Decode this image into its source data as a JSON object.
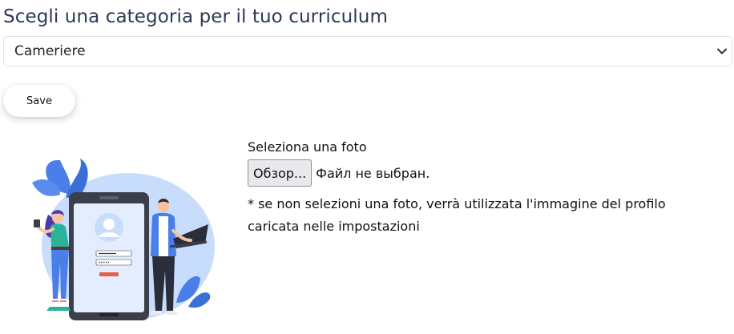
{
  "page": {
    "title": "Scegli una categoria per il tuo curriculum"
  },
  "category_select": {
    "selected": "Cameriere",
    "icon": "chevron-down-icon"
  },
  "save_button": {
    "label": "Save"
  },
  "photo_upload": {
    "label": "Seleziona una foto",
    "browse_label": "Обзор...",
    "file_status": "Файл не выбран.",
    "note": "* se non selezioni una foto, verrà utilizzata l'immagine del profilo caricata nelle impostazioni"
  },
  "colors": {
    "title": "#2b3a55",
    "illustration_blue": "#4a7ee8",
    "illustration_light": "#c8dcfb",
    "phone_dark": "#3a3f4b",
    "accent_red": "#e85c4a"
  }
}
